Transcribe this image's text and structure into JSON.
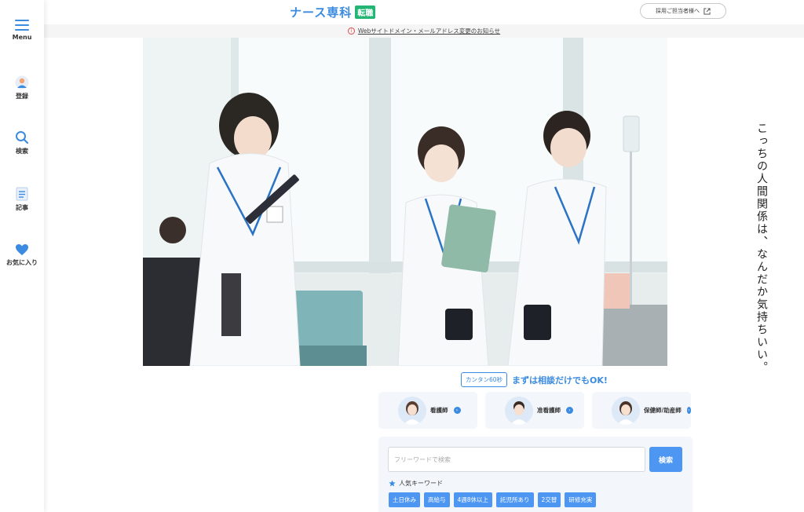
{
  "sidebar": {
    "menu_label": "Menu",
    "register_label": "登録",
    "search_label": "検索",
    "articles_label": "記事",
    "favorites_label": "お気に入り"
  },
  "header": {
    "logo_text": "ナース専科",
    "logo_badge": "転職",
    "recruiter_button": "採用ご担当者様へ"
  },
  "notice": {
    "text": "Webサイトドメイン・メールアドレス変更のお知らせ"
  },
  "hero": {
    "catchcopy": "こっちの人間関係は、なんだか気持ちいい。"
  },
  "cta": {
    "badge": "カンタン60秒",
    "text": "まずは相談だけでもOK!"
  },
  "roles": [
    {
      "label": "看護師"
    },
    {
      "label": "准看護師"
    },
    {
      "label": "保健師/助産師"
    }
  ],
  "search": {
    "placeholder": "フリーワードで検索",
    "button_label": "検索",
    "keywords_title": "人気キーワード",
    "keywords": [
      "土日休み",
      "高給与",
      "4週8休以上",
      "託児所あり",
      "2交替",
      "研修充実"
    ]
  },
  "colors": {
    "accent": "#3b8be0",
    "button": "#4d97f2",
    "badge_green": "#22b573"
  }
}
